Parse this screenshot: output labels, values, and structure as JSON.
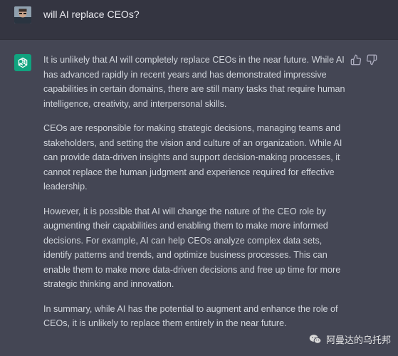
{
  "user_message": {
    "text": "will AI replace CEOs?"
  },
  "assistant_message": {
    "paragraphs": [
      "It is unlikely that AI will completely replace CEOs in the near future. While AI has advanced rapidly in recent years and has demonstrated impressive capabilities in certain domains, there are still many tasks that require human intelligence, creativity, and interpersonal skills.",
      "CEOs are responsible for making strategic decisions, managing teams and stakeholders, and setting the vision and culture of an organization. While AI can provide data-driven insights and support decision-making processes, it cannot replace the human judgment and experience required for effective leadership.",
      "However, it is possible that AI will change the nature of the CEO role by augmenting their capabilities and enabling them to make more informed decisions. For example, AI can help CEOs analyze complex data sets, identify patterns and trends, and optimize business processes. This can enable them to make more data-driven decisions and free up time for more strategic thinking and innovation.",
      "In summary, while AI has the potential to augment and enhance the role of CEOs, it is unlikely to replace them entirely in the near future."
    ]
  },
  "icons": {
    "user_avatar": "user-avatar",
    "assistant_avatar": "openai-logo-icon",
    "thumb_up": "thumb-up-icon",
    "thumb_down": "thumb-down-icon",
    "watermark": "wechat-icon"
  },
  "watermark": {
    "text": "阿曼达的乌托邦"
  },
  "colors": {
    "user_bg": "#343541",
    "assistant_bg": "#444654",
    "accent": "#10a37f",
    "text": "#d1d5db"
  }
}
